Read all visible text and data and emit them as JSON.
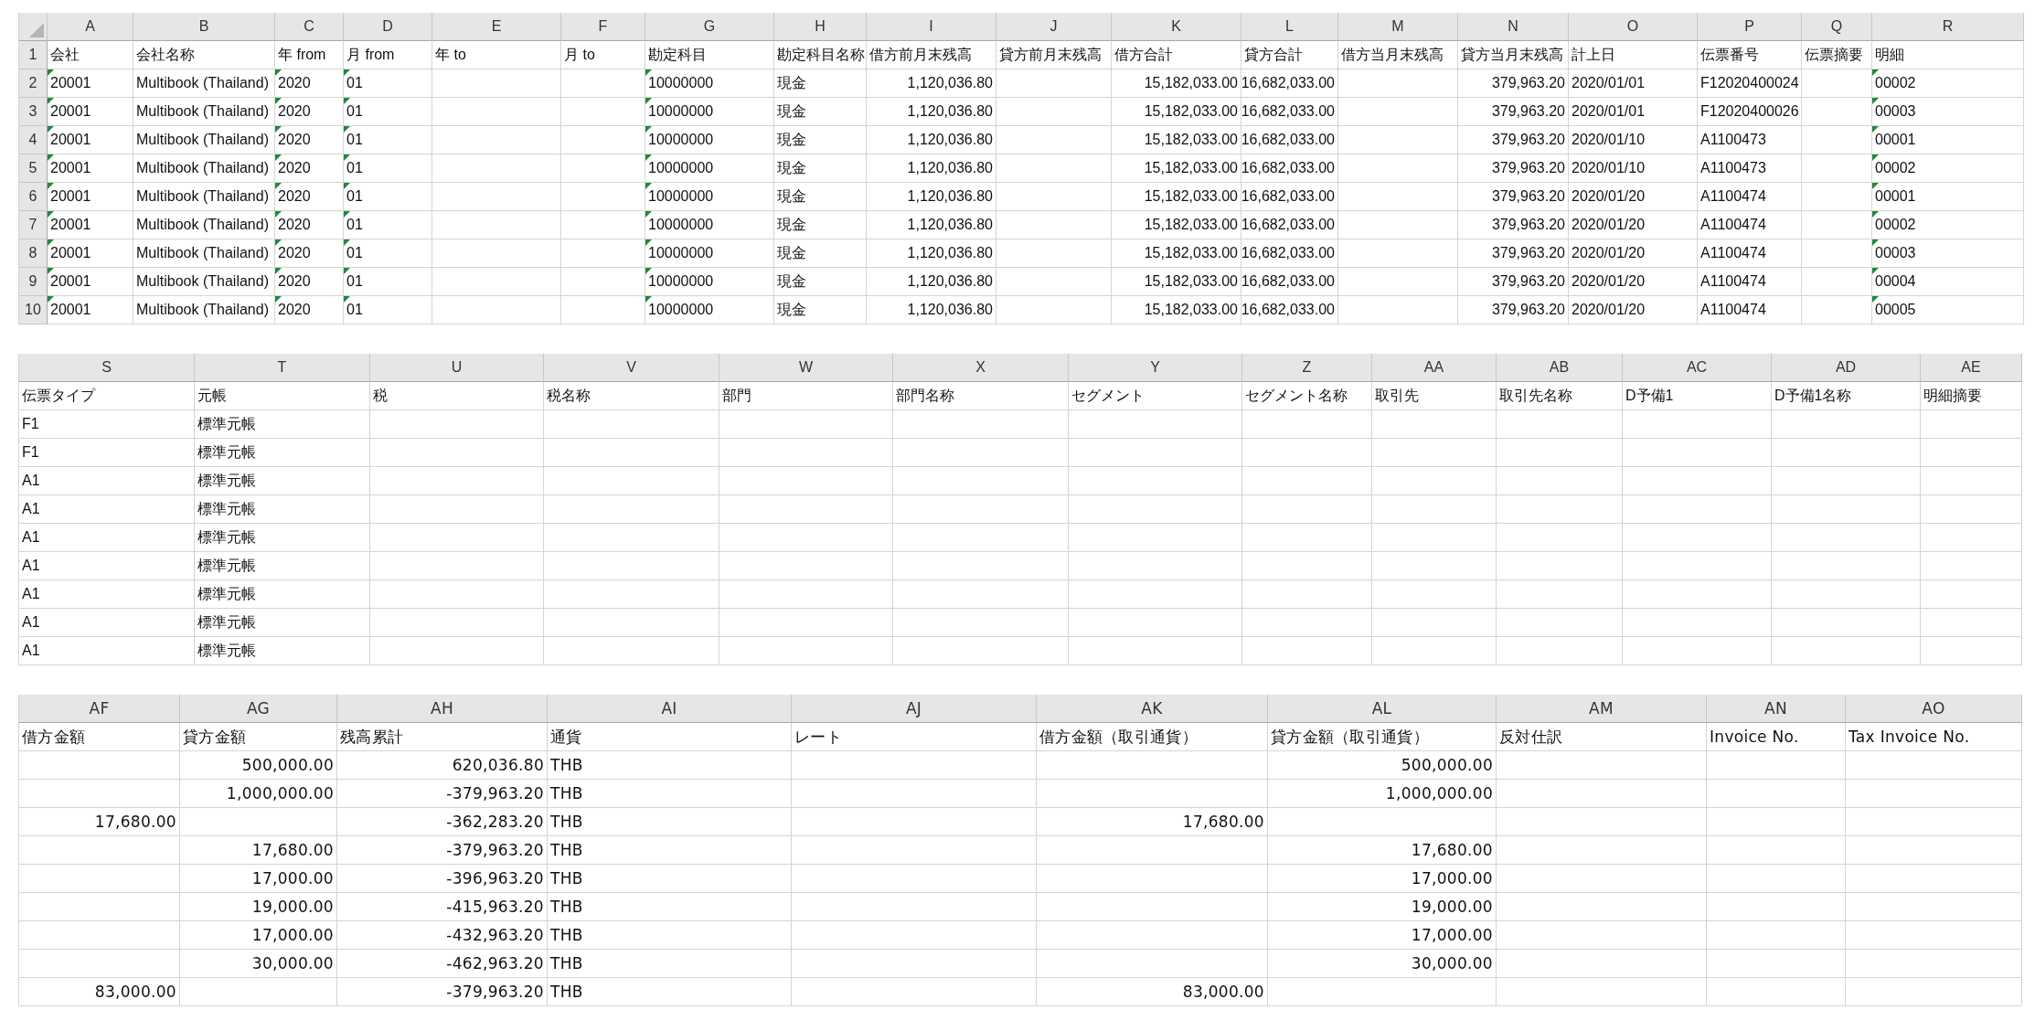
{
  "sheets": [
    {
      "row_numbers": [
        "1",
        "2",
        "3",
        "4",
        "5",
        "6",
        "7",
        "8",
        "9",
        "10"
      ],
      "columns": [
        {
          "letter": "A",
          "kind": "flagged"
        },
        {
          "letter": "B",
          "kind": "text"
        },
        {
          "letter": "C",
          "kind": "flagged"
        },
        {
          "letter": "D",
          "kind": "flagged"
        },
        {
          "letter": "E"
        },
        {
          "letter": "F"
        },
        {
          "letter": "G",
          "kind": "flagged"
        },
        {
          "letter": "H",
          "kind": "text"
        },
        {
          "letter": "I",
          "kind": "number"
        },
        {
          "letter": "J"
        },
        {
          "letter": "K",
          "kind": "number"
        },
        {
          "letter": "L",
          "kind": "number"
        },
        {
          "letter": "M"
        },
        {
          "letter": "N",
          "kind": "number"
        },
        {
          "letter": "O",
          "kind": "text"
        },
        {
          "letter": "P",
          "kind": "text"
        },
        {
          "letter": "Q"
        },
        {
          "letter": "R",
          "kind": "flagged"
        }
      ],
      "rows": [
        [
          "会社",
          "会社名称",
          "年 from",
          "月 from",
          "年 to",
          "月 to",
          "勘定科目",
          "勘定科目名称",
          "借方前月末残高",
          "貸方前月末残高",
          "借方合計",
          "貸方合計",
          "借方当月末残高",
          "貸方当月末残高",
          "計上日",
          "伝票番号",
          "伝票摘要",
          "明細"
        ],
        [
          "20001",
          "Multibook (Thailand)",
          "2020",
          "01",
          "",
          "",
          "10000000",
          "現金",
          "1,120,036.80",
          "",
          "15,182,033.00",
          "16,682,033.00",
          "",
          "379,963.20",
          "2020/01/01",
          "F12020400024",
          "",
          "00002"
        ],
        [
          "20001",
          "Multibook (Thailand)",
          "2020",
          "01",
          "",
          "",
          "10000000",
          "現金",
          "1,120,036.80",
          "",
          "15,182,033.00",
          "16,682,033.00",
          "",
          "379,963.20",
          "2020/01/01",
          "F12020400026",
          "",
          "00003"
        ],
        [
          "20001",
          "Multibook (Thailand)",
          "2020",
          "01",
          "",
          "",
          "10000000",
          "現金",
          "1,120,036.80",
          "",
          "15,182,033.00",
          "16,682,033.00",
          "",
          "379,963.20",
          "2020/01/10",
          "A1100473",
          "",
          "00001"
        ],
        [
          "20001",
          "Multibook (Thailand)",
          "2020",
          "01",
          "",
          "",
          "10000000",
          "現金",
          "1,120,036.80",
          "",
          "15,182,033.00",
          "16,682,033.00",
          "",
          "379,963.20",
          "2020/01/10",
          "A1100473",
          "",
          "00002"
        ],
        [
          "20001",
          "Multibook (Thailand)",
          "2020",
          "01",
          "",
          "",
          "10000000",
          "現金",
          "1,120,036.80",
          "",
          "15,182,033.00",
          "16,682,033.00",
          "",
          "379,963.20",
          "2020/01/20",
          "A1100474",
          "",
          "00001"
        ],
        [
          "20001",
          "Multibook (Thailand)",
          "2020",
          "01",
          "",
          "",
          "10000000",
          "現金",
          "1,120,036.80",
          "",
          "15,182,033.00",
          "16,682,033.00",
          "",
          "379,963.20",
          "2020/01/20",
          "A1100474",
          "",
          "00002"
        ],
        [
          "20001",
          "Multibook (Thailand)",
          "2020",
          "01",
          "",
          "",
          "10000000",
          "現金",
          "1,120,036.80",
          "",
          "15,182,033.00",
          "16,682,033.00",
          "",
          "379,963.20",
          "2020/01/20",
          "A1100474",
          "",
          "00003"
        ],
        [
          "20001",
          "Multibook (Thailand)",
          "2020",
          "01",
          "",
          "",
          "10000000",
          "現金",
          "1,120,036.80",
          "",
          "15,182,033.00",
          "16,682,033.00",
          "",
          "379,963.20",
          "2020/01/20",
          "A1100474",
          "",
          "00004"
        ],
        [
          "20001",
          "Multibook (Thailand)",
          "2020",
          "01",
          "",
          "",
          "10000000",
          "現金",
          "1,120,036.80",
          "",
          "15,182,033.00",
          "16,682,033.00",
          "",
          "379,963.20",
          "2020/01/20",
          "A1100474",
          "",
          "00005"
        ]
      ]
    },
    {
      "columns": [
        {
          "letter": "S",
          "kind": "text"
        },
        {
          "letter": "T",
          "kind": "text"
        },
        {
          "letter": "U"
        },
        {
          "letter": "V"
        },
        {
          "letter": "W"
        },
        {
          "letter": "X"
        },
        {
          "letter": "Y"
        },
        {
          "letter": "Z"
        },
        {
          "letter": "AA"
        },
        {
          "letter": "AB"
        },
        {
          "letter": "AC"
        },
        {
          "letter": "AD"
        },
        {
          "letter": "AE"
        }
      ],
      "rows": [
        [
          "伝票タイプ",
          "元帳",
          "税",
          "税名称",
          "部門",
          "部門名称",
          "セグメント",
          "セグメント名称",
          "取引先",
          "取引先名称",
          "D予備1",
          "D予備1名称",
          "明細摘要"
        ],
        [
          "F1",
          "標準元帳",
          "",
          "",
          "",
          "",
          "",
          "",
          "",
          "",
          "",
          "",
          ""
        ],
        [
          "F1",
          "標準元帳",
          "",
          "",
          "",
          "",
          "",
          "",
          "",
          "",
          "",
          "",
          ""
        ],
        [
          "A1",
          "標準元帳",
          "",
          "",
          "",
          "",
          "",
          "",
          "",
          "",
          "",
          "",
          ""
        ],
        [
          "A1",
          "標準元帳",
          "",
          "",
          "",
          "",
          "",
          "",
          "",
          "",
          "",
          "",
          ""
        ],
        [
          "A1",
          "標準元帳",
          "",
          "",
          "",
          "",
          "",
          "",
          "",
          "",
          "",
          "",
          ""
        ],
        [
          "A1",
          "標準元帳",
          "",
          "",
          "",
          "",
          "",
          "",
          "",
          "",
          "",
          "",
          ""
        ],
        [
          "A1",
          "標準元帳",
          "",
          "",
          "",
          "",
          "",
          "",
          "",
          "",
          "",
          "",
          ""
        ],
        [
          "A1",
          "標準元帳",
          "",
          "",
          "",
          "",
          "",
          "",
          "",
          "",
          "",
          "",
          ""
        ],
        [
          "A1",
          "標準元帳",
          "",
          "",
          "",
          "",
          "",
          "",
          "",
          "",
          "",
          "",
          ""
        ]
      ]
    },
    {
      "columns": [
        {
          "letter": "AF",
          "kind": "number"
        },
        {
          "letter": "AG",
          "kind": "number"
        },
        {
          "letter": "AH",
          "kind": "number"
        },
        {
          "letter": "AI",
          "kind": "text"
        },
        {
          "letter": "AJ"
        },
        {
          "letter": "AK",
          "kind": "number"
        },
        {
          "letter": "AL",
          "kind": "number"
        },
        {
          "letter": "AM"
        },
        {
          "letter": "AN"
        },
        {
          "letter": "AO"
        }
      ],
      "rows": [
        [
          "借方金額",
          "貸方金額",
          "残高累計",
          "通貨",
          "レート",
          "借方金額（取引通貨）",
          "貸方金額（取引通貨）",
          "反対仕訳",
          "Invoice No.",
          "Tax Invoice No."
        ],
        [
          "",
          "500,000.00",
          "620,036.80",
          "THB",
          "",
          "",
          "500,000.00",
          "",
          "",
          ""
        ],
        [
          "",
          "1,000,000.00",
          "-379,963.20",
          "THB",
          "",
          "",
          "1,000,000.00",
          "",
          "",
          ""
        ],
        [
          "17,680.00",
          "",
          "-362,283.20",
          "THB",
          "",
          "17,680.00",
          "",
          "",
          "",
          ""
        ],
        [
          "",
          "17,680.00",
          "-379,963.20",
          "THB",
          "",
          "",
          "17,680.00",
          "",
          "",
          ""
        ],
        [
          "",
          "17,000.00",
          "-396,963.20",
          "THB",
          "",
          "",
          "17,000.00",
          "",
          "",
          ""
        ],
        [
          "",
          "19,000.00",
          "-415,963.20",
          "THB",
          "",
          "",
          "19,000.00",
          "",
          "",
          ""
        ],
        [
          "",
          "17,000.00",
          "-432,963.20",
          "THB",
          "",
          "",
          "17,000.00",
          "",
          "",
          ""
        ],
        [
          "",
          "30,000.00",
          "-462,963.20",
          "THB",
          "",
          "",
          "30,000.00",
          "",
          "",
          ""
        ],
        [
          "83,000.00",
          "",
          "-379,963.20",
          "THB",
          "",
          "83,000.00",
          "",
          "",
          "",
          ""
        ]
      ]
    }
  ]
}
